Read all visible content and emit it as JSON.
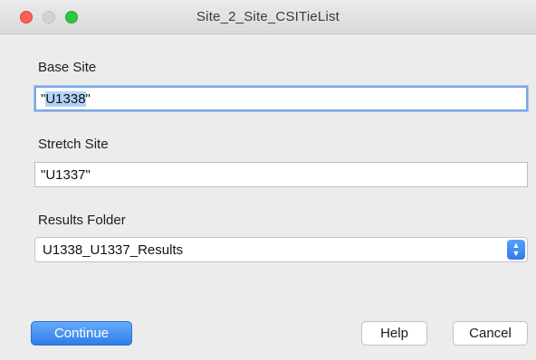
{
  "window": {
    "title": "Site_2_Site_CSITieList"
  },
  "base_site": {
    "label": "Base Site",
    "value_prefix": "\"",
    "value_selected": "U1338",
    "value_suffix": "\""
  },
  "stretch_site": {
    "label": "Stretch Site",
    "value": "\"U1337\""
  },
  "results_folder": {
    "label": "Results Folder",
    "selected": "U1338_U1337_Results",
    "stepper_up": "▲",
    "stepper_down": "▼"
  },
  "buttons": {
    "continue": "Continue",
    "help": "Help",
    "cancel": "Cancel"
  },
  "colors": {
    "accent": "#2f7ee8",
    "close": "#fc5f57",
    "zoom": "#2ac940",
    "minimize": "#d3d3d3"
  }
}
